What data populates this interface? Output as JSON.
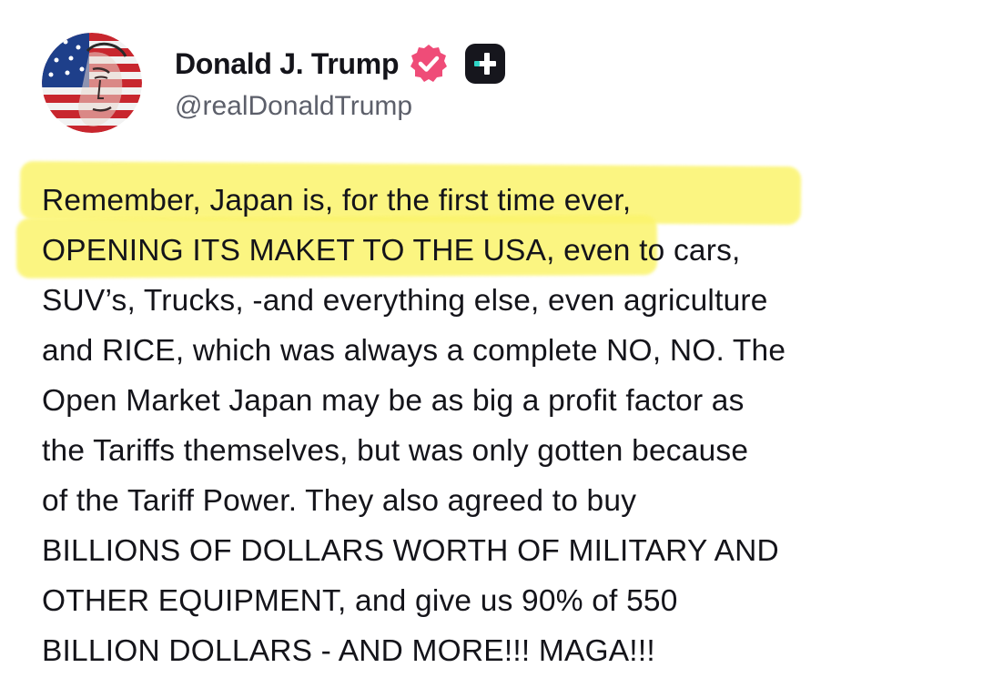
{
  "author": {
    "display_name": "Donald J. Trump",
    "handle": "@realDonaldTrump",
    "avatar": "american-flag-portrait",
    "verified_badge_color": "#ef4c78",
    "truth_plus_badge_color": "#16161d",
    "truth_plus_accent_color": "#2fd5c6"
  },
  "post": {
    "highlight_color": "#fbf46c",
    "lines": [
      "Remember, Japan is, for the first time ever,",
      "OPENING ITS MAKET TO THE USA, even to cars,",
      "SUV’s, Trucks, -and everything else, even agriculture",
      "and RICE, which was always a complete NO, NO. The",
      "Open Market Japan may be as big a profit factor as",
      "the Tariffs themselves, but was only gotten because",
      "of the Tariff Power. They also agreed to buy",
      "BILLIONS OF DOLLARS WORTH OF MILITARY AND",
      "OTHER EQUIPMENT, and give us 90% of 550",
      "BILLION DOLLARS - AND MORE!!! MAGA!!!"
    ]
  }
}
